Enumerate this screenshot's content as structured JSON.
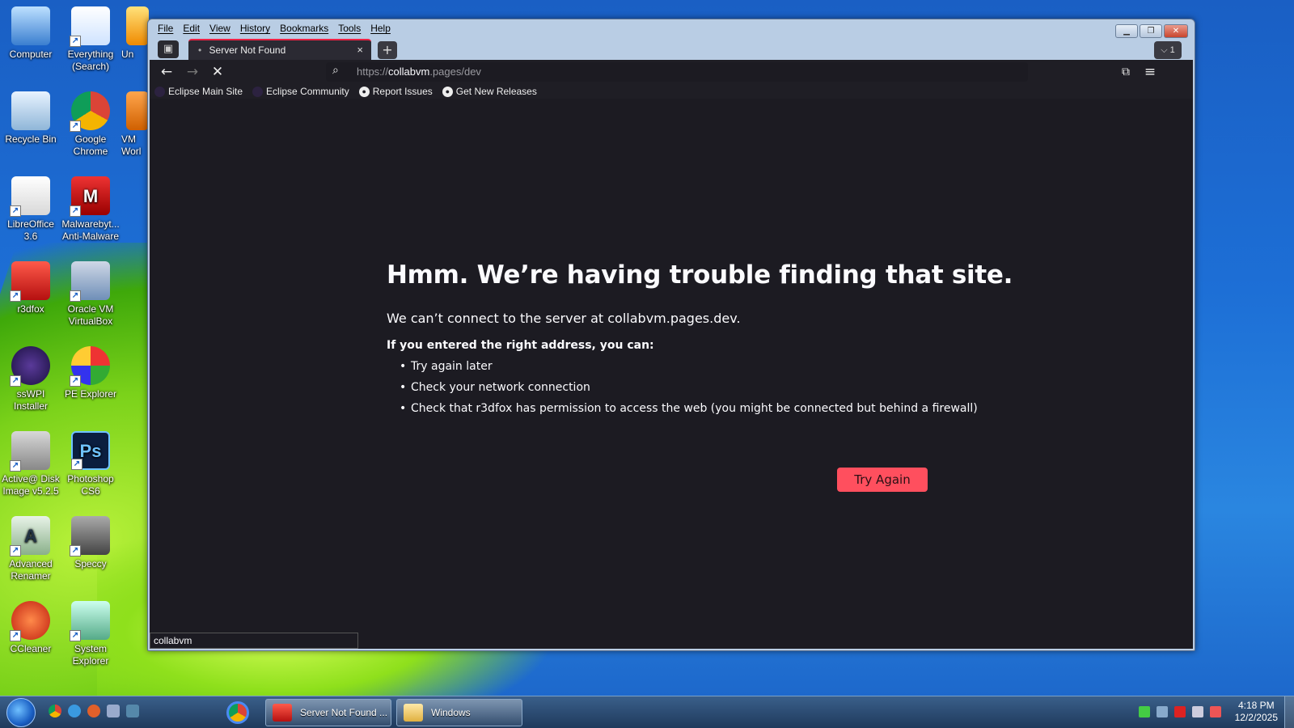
{
  "desktop": {
    "icons": [
      {
        "label": "Computer"
      },
      {
        "label": "Everything (Search)"
      },
      {
        "label": "Un"
      },
      {
        "label": "Recycle Bin"
      },
      {
        "label": "Google Chrome"
      },
      {
        "label": "VM Worl"
      },
      {
        "label": "LibreOffice 3.6"
      },
      {
        "label": "Malwarebyt... Anti-Malware"
      },
      {
        "label": "r3dfox"
      },
      {
        "label": "Oracle VM VirtualBox"
      },
      {
        "label": "ssWPI Installer"
      },
      {
        "label": "PE Explorer"
      },
      {
        "label": "Active@ Disk Image v5.2.5"
      },
      {
        "label": "Photoshop CS6"
      },
      {
        "label": "Advanced Renamer"
      },
      {
        "label": "Speccy"
      },
      {
        "label": "CCleaner"
      },
      {
        "label": "System Explorer"
      }
    ]
  },
  "browser": {
    "menu": [
      "File",
      "Edit",
      "View",
      "History",
      "Bookmarks",
      "Tools",
      "Help"
    ],
    "tab": {
      "title": "Server Not Found",
      "close": "×"
    },
    "new_tab": "+",
    "tab_count": "1",
    "url": {
      "scheme": "https://",
      "host": "collabvm",
      "path": ".pages/dev"
    },
    "bookmarks": [
      "Eclipse Main Site",
      "Eclipse Community",
      "Report Issues",
      "Get New Releases"
    ],
    "error": {
      "title": "Hmm. We’re having trouble finding that site.",
      "message": "We can’t connect to the server at collabvm.pages.dev.",
      "subtitle": "If you entered the right address, you can:",
      "suggestions": [
        "Try again later",
        "Check your network connection",
        "Check that r3dfox has permission to access the web (you might be connected but behind a firewall)"
      ],
      "button": "Try Again"
    },
    "status": "collabvm"
  },
  "taskbar": {
    "items": [
      {
        "label": "Server Not Found ..."
      },
      {
        "label": "Windows"
      }
    ],
    "clock": {
      "time": "4:18 PM",
      "date": "12/2/2025"
    }
  }
}
